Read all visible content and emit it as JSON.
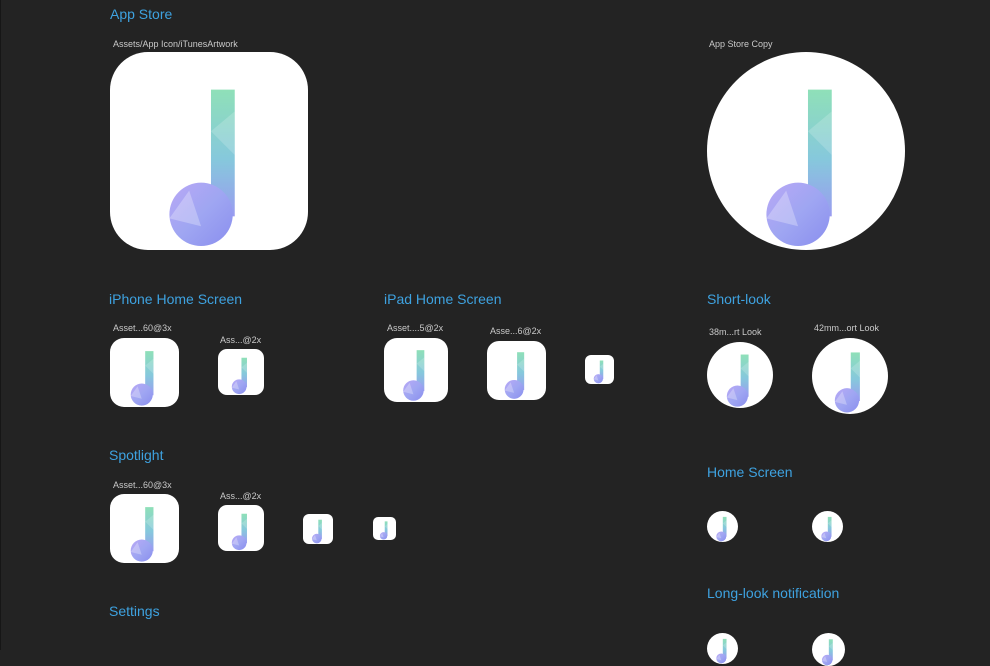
{
  "sections": {
    "app_store": {
      "title": "App Store",
      "label_artwork": "Assets/App Icon/iTunesArtwork",
      "label_copy": "App Store Copy"
    },
    "iphone_home": {
      "title": "iPhone Home Screen",
      "label_large": "Asset...60@3x",
      "label_small": "Ass...@2x"
    },
    "ipad_home": {
      "title": "iPad Home Screen",
      "label_large": "Asset....5@2x",
      "label_mid": "Asse...6@2x"
    },
    "short_look": {
      "title": "Short-look",
      "label_38": "38m...rt Look",
      "label_42": "42mm...ort Look"
    },
    "spotlight": {
      "title": "Spotlight",
      "label_large": "Asset...60@3x",
      "label_small": "Ass...@2x"
    },
    "home_screen": {
      "title": "Home Screen"
    },
    "settings": {
      "title": "Settings"
    },
    "long_look": {
      "title": "Long-look notification"
    }
  },
  "icons": {
    "glyph": "music-note-icon"
  },
  "colors": {
    "background": "#232323",
    "title": "#3ea2e0",
    "label": "#c9c9c9",
    "icon_bg": "#ffffff"
  }
}
